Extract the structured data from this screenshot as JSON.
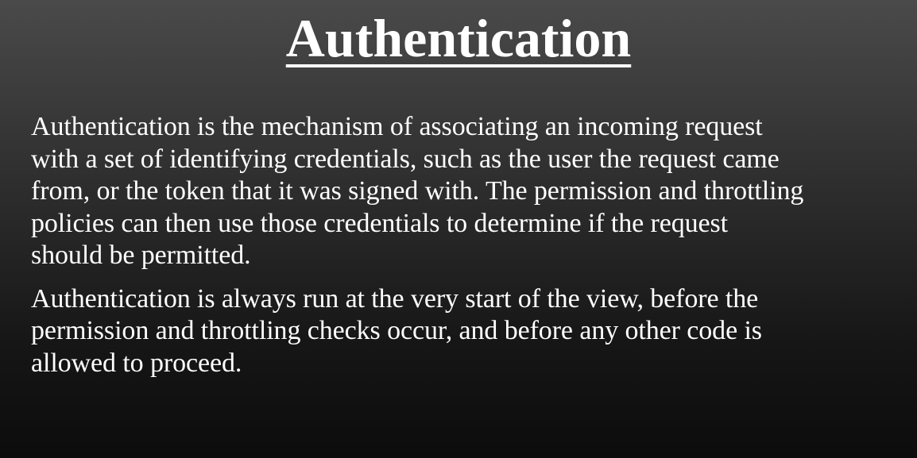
{
  "slide": {
    "title": "Authentication",
    "paragraphs": [
      {
        "lines": [
          "Authentication is the mechanism of associating an incoming request",
          "with a set of identifying credentials, such as the user the request came",
          "from, or the token that it was signed with. The permission and throttling",
          "policies can then use those credentials to determine if the request",
          "should be permitted."
        ]
      },
      {
        "lines": [
          "Authentication is always run at the very start of the view, before the",
          "permission and throttling checks occur, and before any other code is",
          "allowed to proceed."
        ]
      }
    ]
  }
}
